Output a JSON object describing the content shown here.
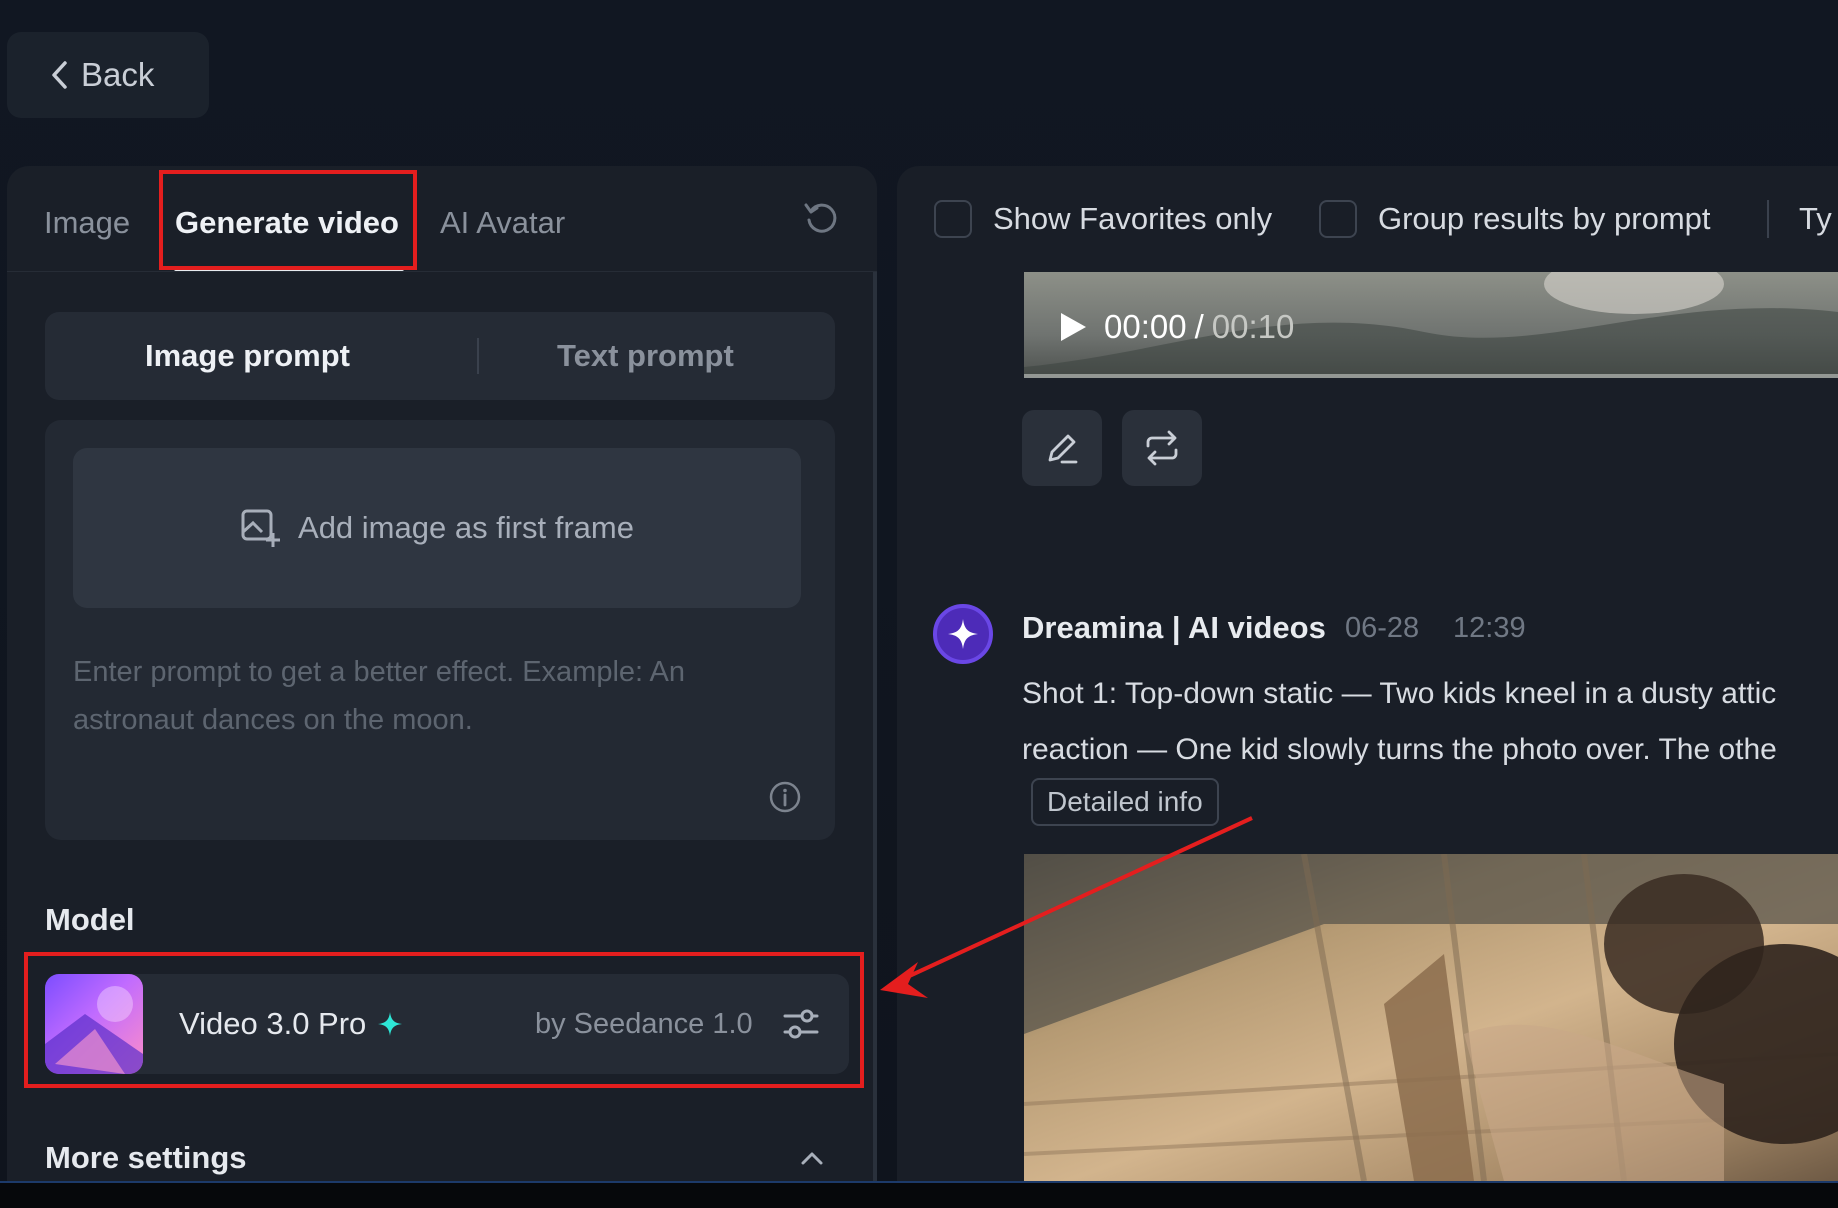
{
  "back_label": "Back",
  "tabs": [
    {
      "label": "Image",
      "active": false
    },
    {
      "label": "Generate video",
      "active": true
    },
    {
      "label": "AI Avatar",
      "active": false
    }
  ],
  "prompt_switch": {
    "image": "Image prompt",
    "text": "Text prompt"
  },
  "add_frame_label": "Add image as first frame",
  "prompt_placeholder": "Enter prompt to get a better effect. Example: An astronaut dances on the moon.",
  "model_section": {
    "label": "Model",
    "name": "Video 3.0 Pro",
    "by": "by Seedance 1.0"
  },
  "more_settings_label": "More settings",
  "filters": {
    "favorites": "Show Favorites only",
    "group": "Group results by prompt",
    "type_partial": "Ty"
  },
  "video_player": {
    "current": "00:00",
    "separator": "/",
    "total": "00:10"
  },
  "post": {
    "author": "Dreamina | AI videos",
    "date": "06-28",
    "time": "12:39",
    "line1": "Shot 1: Top-down static — Two kids kneel in a dusty attic",
    "line2": "reaction — One kid slowly turns the photo over. The othe",
    "detail_label": "Detailed info"
  },
  "colors": {
    "highlight": "#e41e1e",
    "accent_sparkle": "#2ee6d6"
  }
}
